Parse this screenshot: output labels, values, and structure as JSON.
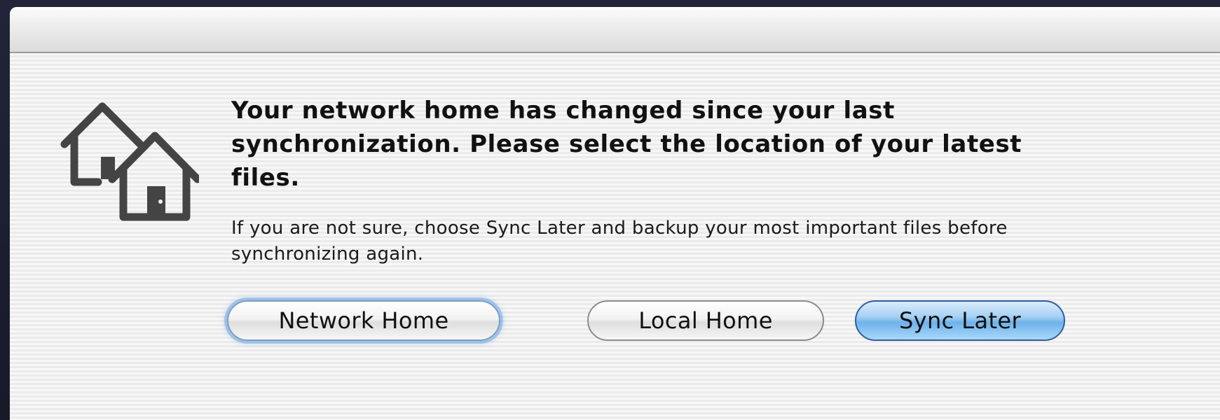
{
  "dialog": {
    "icon": "network-home-icon",
    "headline": "Your network home has changed since your last synchronization.  Please select the location of your latest files.",
    "detail": "If you are not sure, choose Sync Later and backup your most important files before synchronizing again.",
    "buttons": {
      "network_home": "Network Home",
      "local_home": "Local Home",
      "sync_later": "Sync Later"
    }
  },
  "colors": {
    "default_button": "#6eb2ea",
    "focus_ring": "#78aae1",
    "text": "#111111"
  }
}
